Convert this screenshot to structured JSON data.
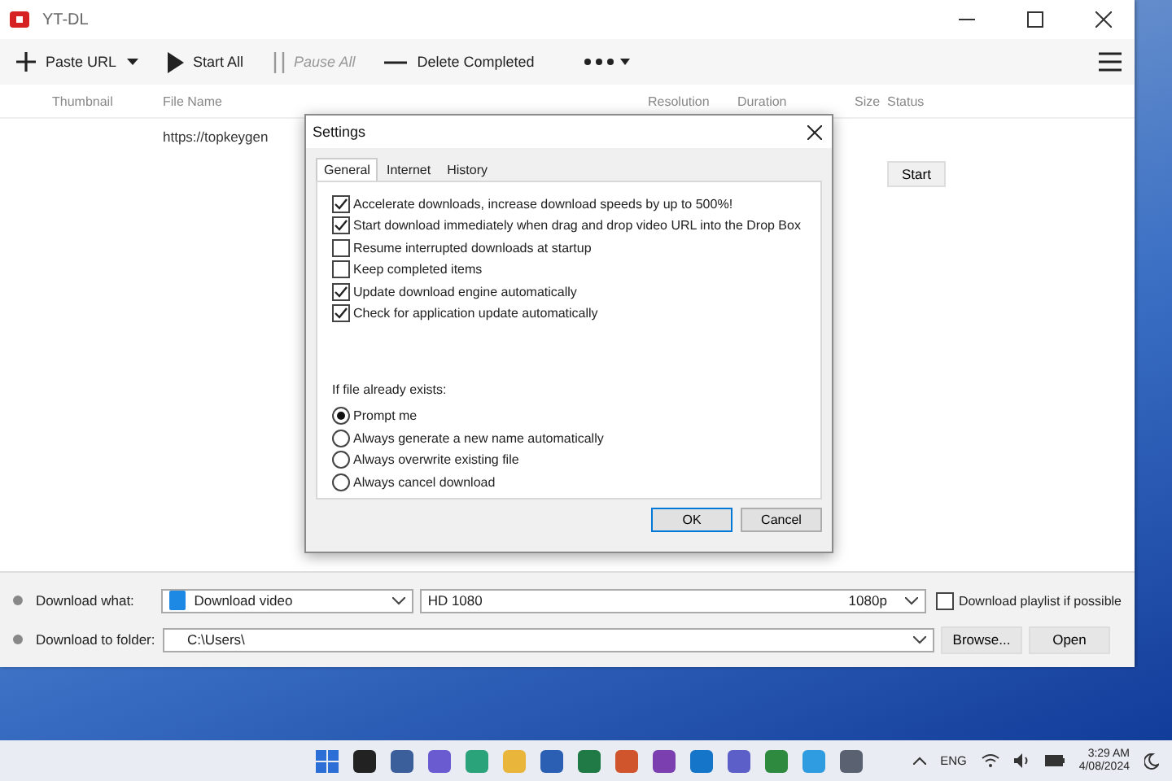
{
  "window": {
    "title": "YT-DL"
  },
  "toolbar": [
    {
      "kind": "paste",
      "label": "Paste URL",
      "disabled": false
    },
    {
      "kind": "start",
      "label": "Start All",
      "disabled": false
    },
    {
      "kind": "pause",
      "label": "Pause All",
      "disabled": true
    },
    {
      "kind": "delete",
      "label": "Delete Completed",
      "disabled": false
    },
    {
      "kind": "more",
      "disabled": false
    }
  ],
  "table": {
    "columns": [
      "Thumbnail",
      "File Name",
      "Resolution",
      "Duration",
      "Size",
      "Status"
    ],
    "rows": [
      {
        "file_name": "https://topkeygen",
        "action": "Start"
      }
    ]
  },
  "dialog": {
    "title": "Settings",
    "tabs": [
      {
        "label": "General",
        "selected": true
      },
      {
        "label": "Internet",
        "selected": false
      },
      {
        "label": "History",
        "selected": false
      }
    ],
    "options": [
      {
        "label": "Accelerate downloads, increase download speeds by up to 500%!",
        "checked": true
      },
      {
        "label": "Start download immediately when drag and drop video URL into the Drop Box",
        "checked": true
      },
      {
        "label": "Resume interrupted downloads at startup",
        "checked": false
      },
      {
        "label": "Keep completed items",
        "checked": false
      },
      {
        "label": "Update download engine automatically",
        "checked": true
      },
      {
        "label": "Check for application update automatically",
        "checked": true
      }
    ],
    "exists_label": "If file already exists:",
    "exists_choices": [
      {
        "label": "Prompt me",
        "selected": true
      },
      {
        "label": "Always generate a new name automatically",
        "selected": false
      },
      {
        "label": "Always overwrite existing file",
        "selected": false
      },
      {
        "label": "Always cancel download",
        "selected": false
      }
    ],
    "buttons": [
      {
        "label": "OK",
        "default": true
      },
      {
        "label": "Cancel",
        "default": false
      }
    ]
  },
  "download_what": {
    "label": "Download what:",
    "value": "Download video",
    "quality": "HD 1080",
    "quality_tag": "1080p",
    "playlist": {
      "label": "Download playlist if possible",
      "checked": false
    }
  },
  "download_folder": {
    "label": "Download to folder:",
    "value": "C:\\Users\\",
    "buttons": [
      "Browse...",
      "Open"
    ]
  },
  "taskbar": {
    "language": "ENG",
    "time": "3:29 AM",
    "date": "4/08/2024"
  }
}
